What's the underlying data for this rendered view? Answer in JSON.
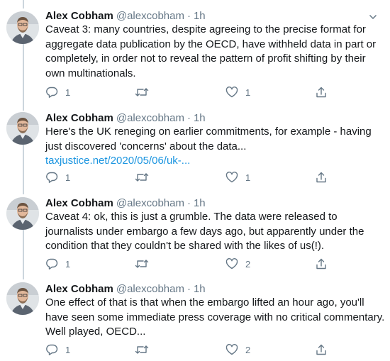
{
  "author": {
    "name": "Alex Cobham",
    "handle": "@alexcobham",
    "dot": "·"
  },
  "icons": {
    "reply": "reply-icon",
    "retweet": "retweet-icon",
    "like": "heart-icon",
    "share": "share-icon",
    "more": "chevron-down-icon",
    "avatar": "avatar-photo"
  },
  "colors": {
    "text": "#14171a",
    "muted": "#657786",
    "link": "#1b95e0",
    "thread_line": "#ccd6dd"
  },
  "tweets": [
    {
      "time": "1h",
      "text": "Caveat 3: many countries, despite agreeing to the precise format for aggregate data publication by the OECD, have withheld data in part or completely, in order not to reveal the pattern of profit shifting by their own multinationals.",
      "link": "",
      "replies": "1",
      "retweets": "",
      "likes": "1"
    },
    {
      "time": "1h",
      "text": "Here's the UK reneging on earlier commitments, for example - having just discovered 'concerns' about the data...",
      "link": "taxjustice.net/2020/05/06/uk-...",
      "replies": "1",
      "retweets": "",
      "likes": "1"
    },
    {
      "time": "1h",
      "text": "Caveat 4: ok, this is just a grumble. The data were released to journalists under embargo a few days ago, but apparently under the condition that they couldn't be shared with the likes of us(!).",
      "link": "",
      "replies": "1",
      "retweets": "",
      "likes": "2"
    },
    {
      "time": "1h",
      "text": "One effect of that is that when the embargo lifted an hour ago, you'll have seen some immediate press coverage with no critical commentary. Well played, OECD...",
      "link": "",
      "replies": "1",
      "retweets": "",
      "likes": "2"
    }
  ]
}
